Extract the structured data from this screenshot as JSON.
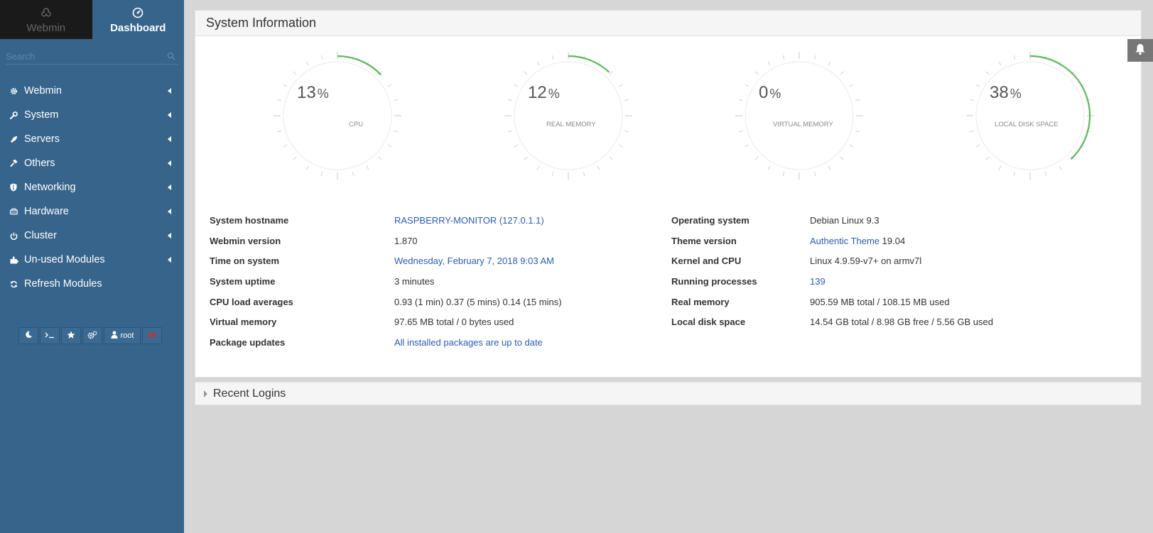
{
  "sidebar": {
    "tabs": [
      {
        "label": "Webmin",
        "icon": "webmin-logo-icon",
        "active": false
      },
      {
        "label": "Dashboard",
        "icon": "dashboard-icon",
        "active": true
      }
    ],
    "search": {
      "placeholder": "Search"
    },
    "menu": [
      {
        "label": "Webmin",
        "icon": "gear-icon"
      },
      {
        "label": "System",
        "icon": "wrench-icon"
      },
      {
        "label": "Servers",
        "icon": "rocket-icon"
      },
      {
        "label": "Others",
        "icon": "gavel-icon"
      },
      {
        "label": "Networking",
        "icon": "shield-icon"
      },
      {
        "label": "Hardware",
        "icon": "hdd-icon"
      },
      {
        "label": "Cluster",
        "icon": "power-icon"
      },
      {
        "label": "Un-used Modules",
        "icon": "puzzle-icon"
      },
      {
        "label": "Refresh Modules",
        "icon": "refresh-icon"
      }
    ],
    "bottom_buttons": {
      "user": "root"
    }
  },
  "main": {
    "system_info": {
      "title": "System Information",
      "gauges": [
        {
          "value": "13",
          "unit": "%",
          "label": "CPU",
          "percent": 13
        },
        {
          "value": "12",
          "unit": "%",
          "label": "REAL MEMORY",
          "percent": 12
        },
        {
          "value": "0",
          "unit": "%",
          "label": "VIRTUAL MEMORY",
          "percent": 0
        },
        {
          "value": "38",
          "unit": "%",
          "label": "LOCAL DISK SPACE",
          "percent": 38
        }
      ],
      "left": [
        {
          "key": "System hostname",
          "value": "RASPBERRY-MONITOR (127.0.1.1)",
          "link": true
        },
        {
          "key": "Webmin version",
          "value": "1.870",
          "link": false
        },
        {
          "key": "Time on system",
          "value": "Wednesday, February 7, 2018 9:03 AM",
          "link": true
        },
        {
          "key": "System uptime",
          "value": "3 minutes",
          "link": false
        },
        {
          "key": "CPU load averages",
          "value": "0.93 (1 min) 0.37 (5 mins) 0.14 (15 mins)",
          "link": false
        },
        {
          "key": "Virtual memory",
          "value": "97.65 MB total / 0 bytes used",
          "link": false
        },
        {
          "key": "Package updates",
          "value": "All installed packages are up to date",
          "link": true
        }
      ],
      "right": [
        {
          "key": "Operating system",
          "value": "Debian Linux 9.3"
        },
        {
          "key": "Theme version",
          "value_link": "Authentic Theme",
          "value_rest": " 19.04"
        },
        {
          "key": "Kernel and CPU",
          "value": "Linux 4.9.59-v7+ on armv7l"
        },
        {
          "key": "Running processes",
          "value": "139",
          "link": true
        },
        {
          "key": "Real memory",
          "value": "905.59 MB total / 108.15 MB used"
        },
        {
          "key": "Local disk space",
          "value": "14.54 GB total / 8.98 GB free / 5.56 GB used"
        }
      ]
    },
    "recent_logins": {
      "title": "Recent Logins"
    }
  },
  "colors": {
    "sidebar": "#36648b",
    "gauge_fill": "#5cb85c",
    "link": "#2a5db0"
  }
}
